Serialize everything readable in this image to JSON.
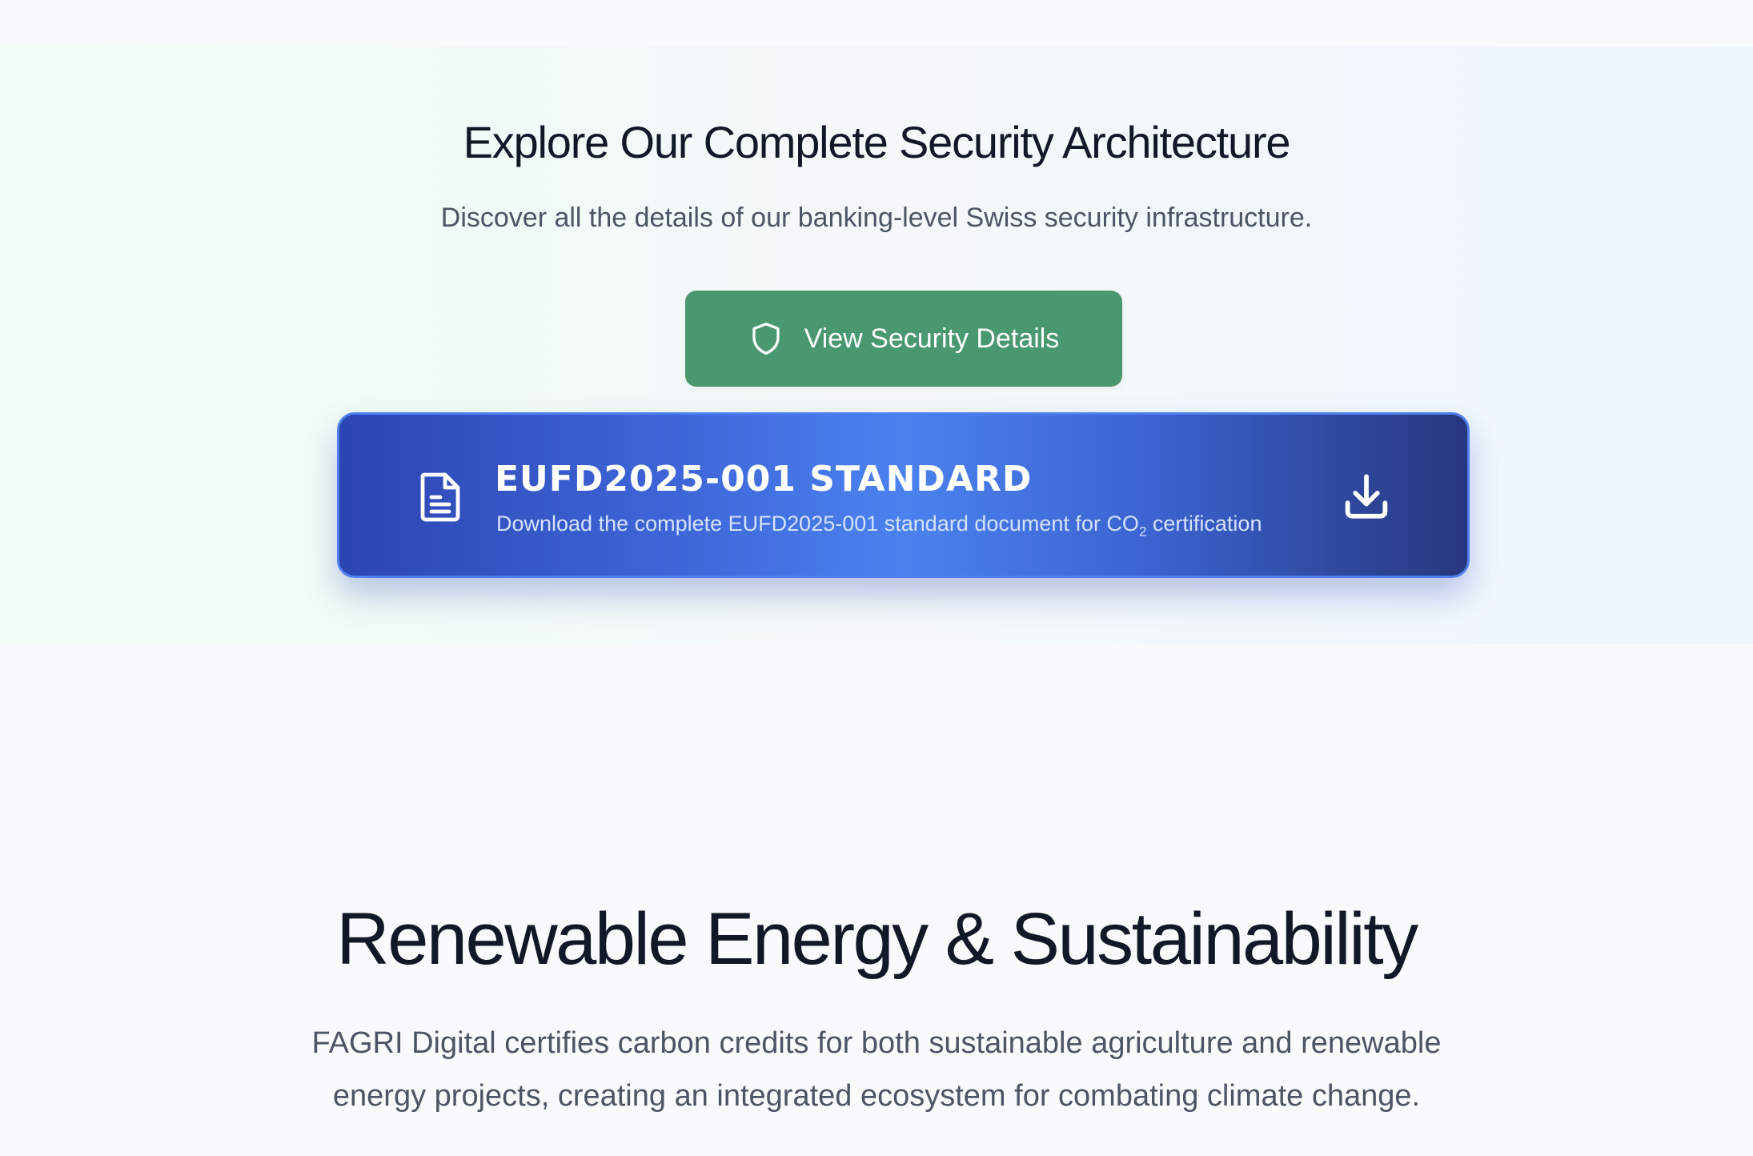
{
  "security_section": {
    "title": "Explore Our Complete Security Architecture",
    "subtitle": "Discover all the details of our banking-level Swiss security infrastructure.",
    "button": {
      "label": "View Security Details",
      "icon": "shield-icon",
      "color": "#4a9870"
    }
  },
  "download_card": {
    "title": "EUFD2025-001 STANDARD",
    "description_prefix": "Download the complete EUFD2025-001 standard document for CO",
    "description_subscript": "2",
    "description_suffix": " certification",
    "left_icon": "document-icon",
    "right_icon": "download-icon",
    "colors": {
      "gradient_start": "#2c45b1",
      "gradient_mid": "#4b82ef",
      "gradient_end": "#27377e",
      "border": "#4f7ff0"
    }
  },
  "renewable_section": {
    "title": "Renewable Energy & Sustainability",
    "text": "FAGRI Digital certifies carbon credits for both sustainable agriculture and renewable energy projects, creating an integrated ecosystem for combating climate change."
  }
}
